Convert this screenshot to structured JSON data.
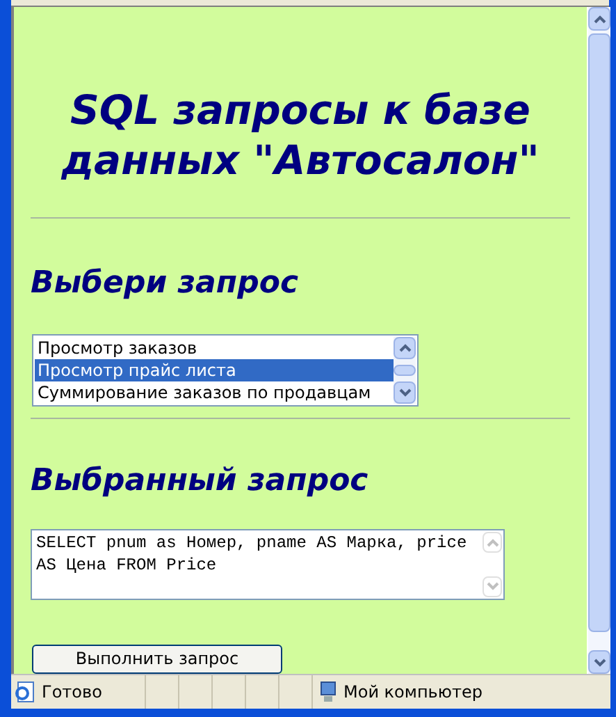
{
  "page": {
    "title": "SQL запросы к базе данных \"Автосалон\""
  },
  "choose_section": {
    "heading": "Выбери запрос",
    "options": [
      {
        "label": "Просмотр заказов",
        "selected": false
      },
      {
        "label": "Просмотр прайс листа",
        "selected": true
      },
      {
        "label": "Суммирование заказов по продавцам",
        "selected": false
      }
    ]
  },
  "query_section": {
    "heading": "Выбранный запрос",
    "value": "SELECT pnum as Номер, pname AS Марка, price AS Цена FROM Price"
  },
  "run_button": {
    "label": "Выполнить запрос"
  },
  "status_bar": {
    "status": "Готово",
    "zone": "Мой компьютер"
  }
}
